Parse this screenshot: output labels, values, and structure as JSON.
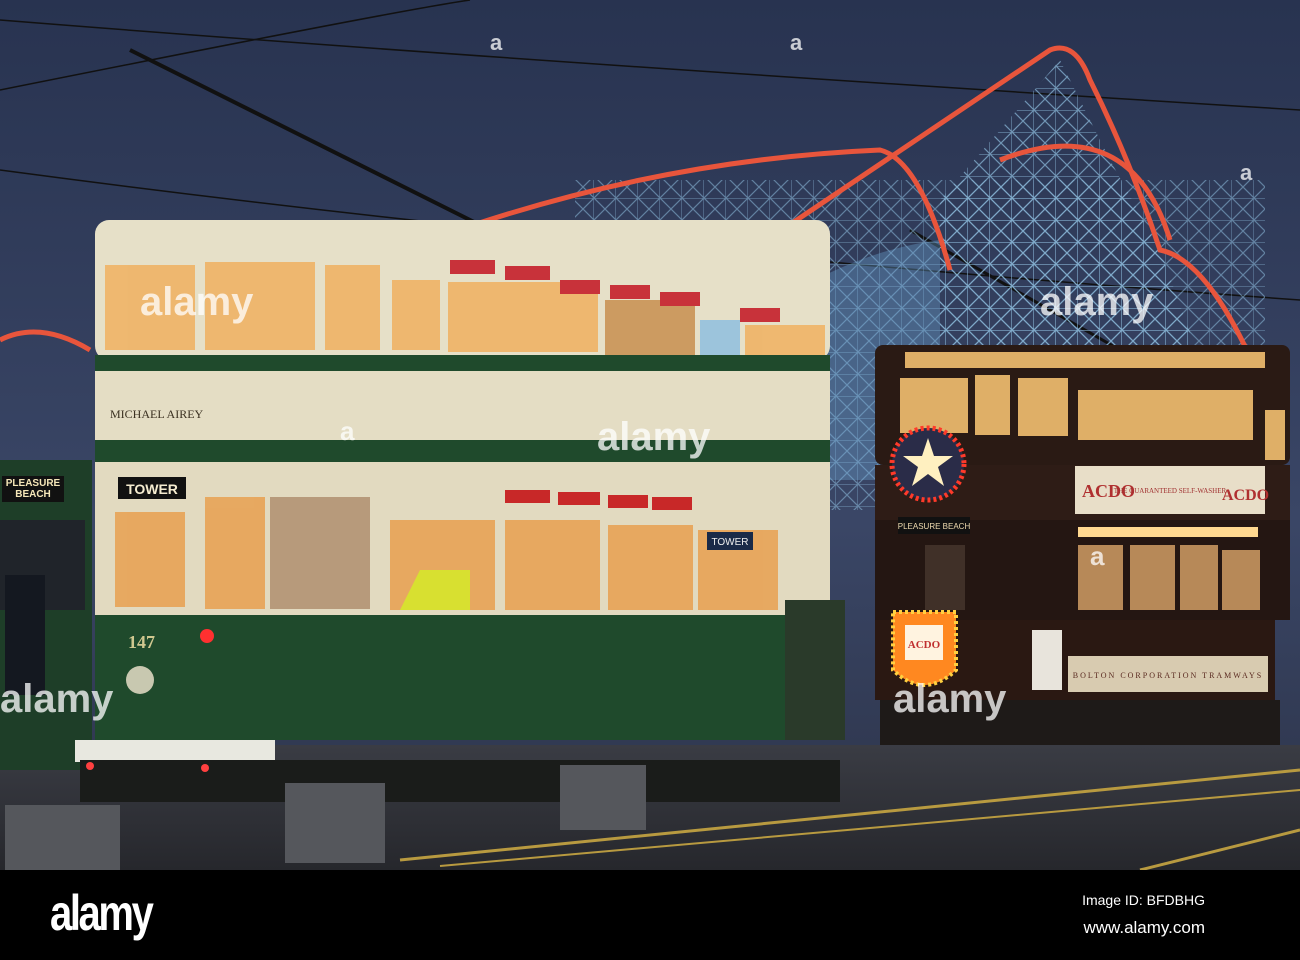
{
  "photo": {
    "left_tram": {
      "name": "MICHAEL AIREY",
      "destination": "TOWER",
      "side_sign": "TOWER",
      "number": "147"
    },
    "far_left_tram": {
      "destination": "PLEASURE BEACH"
    },
    "right_tram": {
      "destination": "PLEASURE BEACH",
      "ad_brand_left": "ACDO",
      "ad_slogan": "THE GUARANTEED SELF-WASHER",
      "ad_brand_right": "ACDO",
      "shield_sign": "ACDO",
      "operator": "BOLTON CORPORATION TRAMWAYS"
    },
    "watermark": "alamy",
    "watermark_mark": "a"
  },
  "footer": {
    "logo": "alamy",
    "image_id": "Image ID: BFDBHG",
    "website": "www.alamy.com"
  },
  "colors": {
    "sky": "#2e3a5a",
    "coaster_red": "#e0503a",
    "coaster_blue": "#7fb4e0",
    "tram_green": "#1f4a2c",
    "tram_cream": "#e6e0c8",
    "tram_brown": "#2a1a14"
  }
}
